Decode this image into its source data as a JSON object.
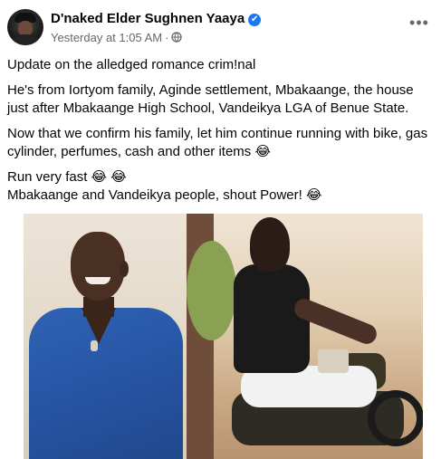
{
  "post": {
    "author": "D'naked Elder Sughnen Yaaya",
    "timestamp": "Yesterday at 1:05 AM",
    "separator": "·",
    "more_label": "•••",
    "verified_mark": "✔",
    "audience_icon": "globe-icon",
    "paragraphs": [
      "Update on the alledged romance crim!nal",
      "He's from Iortyom family, Aginde settlement, Mbakaange, the house just after Mbakaange High School, Vandeikya LGA of Benue State.",
      "Now that we confirm his family, let him continue running with bike, gas cylinder, perfumes, cash and other items 😂"
    ],
    "last_paragraph_line1": "Run very fast 😂 😂",
    "last_paragraph_line2": "Mbakaange and Vandeikya people, shout Power! 😂"
  },
  "colors": {
    "verified_badge": "#1877f2",
    "meta_text": "#65676b",
    "body_text": "#050505"
  }
}
